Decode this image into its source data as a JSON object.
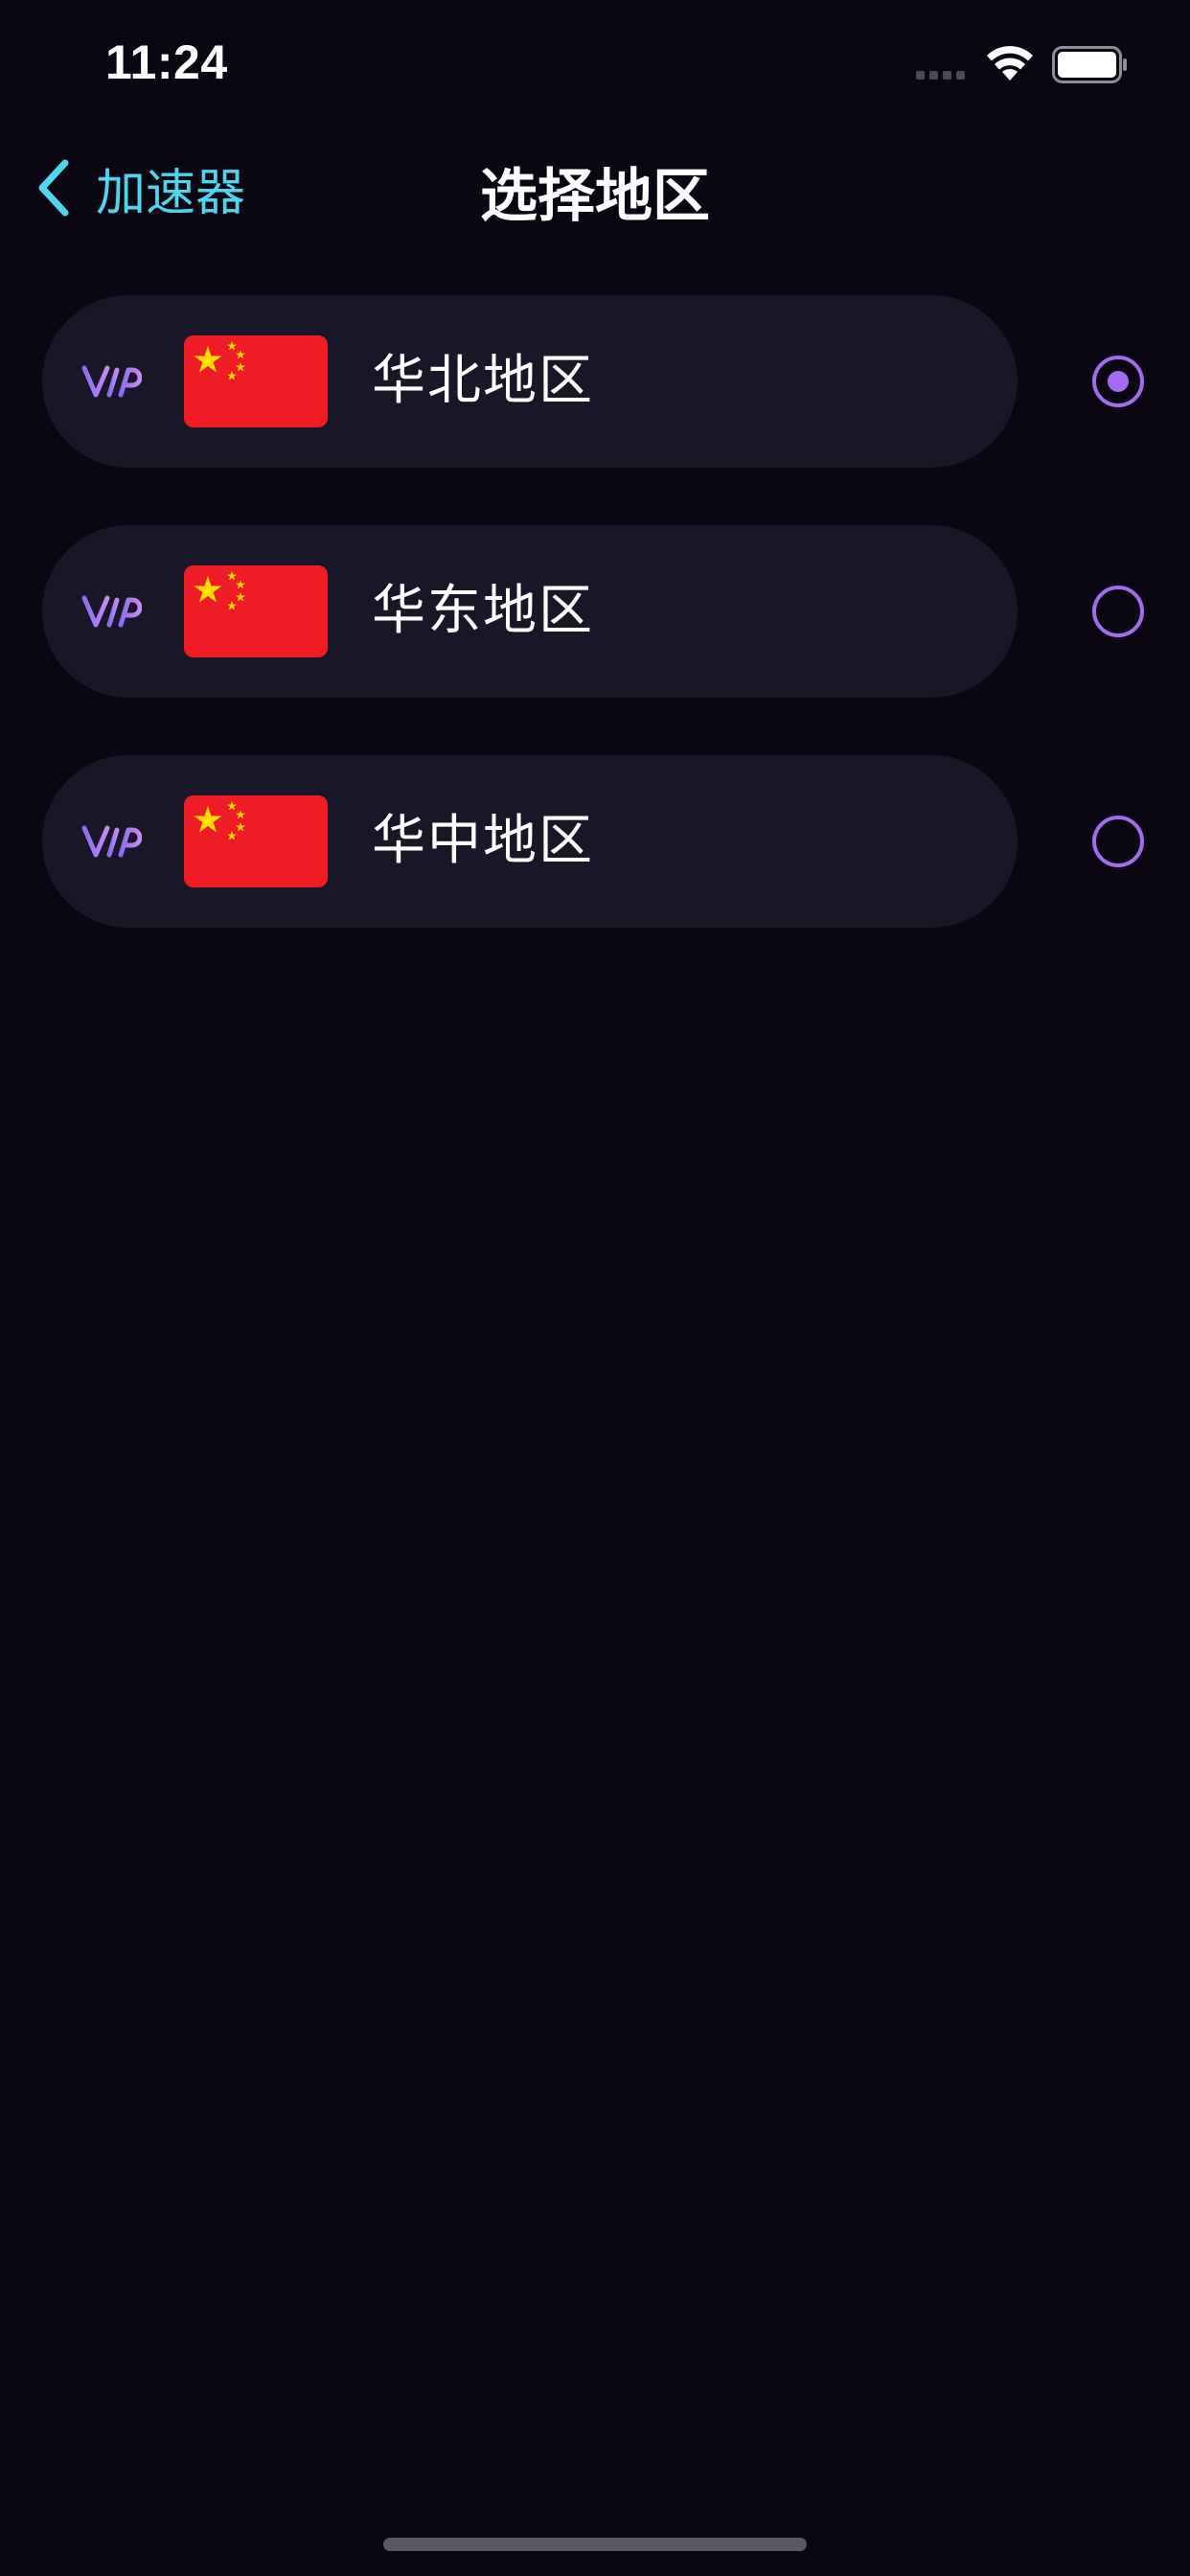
{
  "status_bar": {
    "time": "11:24",
    "wifi_icon": "wifi-icon",
    "battery_icon": "battery-full-icon",
    "cellular_icon": "cellular-no-signal-icon"
  },
  "nav": {
    "back_label": "加速器",
    "back_icon": "chevron-left-icon",
    "title": "选择地区"
  },
  "colors": {
    "background": "#0a0612",
    "card": "#181627",
    "accent_cyan": "#4ed6ee",
    "accent_purple": "#a46bf0",
    "flag_red": "#ee1c25",
    "flag_yellow": "#ffde00"
  },
  "regions": [
    {
      "badge": "VIP",
      "flag": "china-flag-icon",
      "name": "华北地区",
      "selected": true
    },
    {
      "badge": "VIP",
      "flag": "china-flag-icon",
      "name": "华东地区",
      "selected": false
    },
    {
      "badge": "VIP",
      "flag": "china-flag-icon",
      "name": "华中地区",
      "selected": false
    }
  ]
}
